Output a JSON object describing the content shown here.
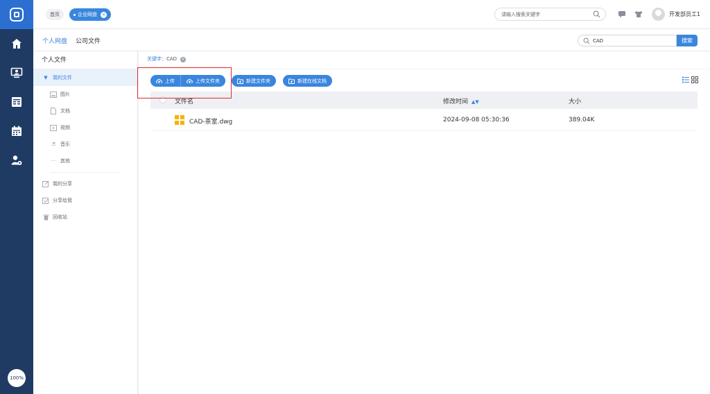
{
  "colors": {
    "accent": "#3a86de",
    "rail": "#1f3b64",
    "rail_logo": "#2b6fd0",
    "highlight_box": "#e02b2b",
    "file_icon": "#f5b400"
  },
  "rail": {
    "items": [
      {
        "name": "home-icon"
      },
      {
        "name": "monitor-user-icon"
      },
      {
        "name": "document-list-icon"
      },
      {
        "name": "calendar-icon"
      },
      {
        "name": "user-settings-icon"
      }
    ],
    "zoom": "100%"
  },
  "topbar": {
    "home_tab": "首页",
    "active_tab": "企业网盘",
    "search_placeholder": "请输入搜索关键字",
    "username": "开发部员工1"
  },
  "tabs": [
    {
      "label": "个人网盘",
      "active": true
    },
    {
      "label": "公司文件",
      "active": false
    }
  ],
  "filter": {
    "value": "CAD",
    "button_label": "搜索"
  },
  "tree": {
    "title": "个人文件",
    "my_files": "我的文件",
    "children": [
      "图片",
      "文档",
      "视频",
      "音乐",
      "其他"
    ],
    "my_share": "我的分享",
    "shared_with_me": "分享给我",
    "recycle_bin": "回收站"
  },
  "main": {
    "keyword_label": "关键字：",
    "keyword_value": "CAD",
    "buttons": {
      "upload": "上传",
      "upload_folder": "上传文件夹",
      "new_folder": "新建文件夹",
      "new_online_doc": "新建在线文档"
    },
    "columns": {
      "name": "文件名",
      "modified": "修改时间",
      "size": "大小"
    },
    "files": [
      {
        "name": "CAD-茶室.dwg",
        "modified": "2024-09-08 05:30:36",
        "size": "389.04K"
      }
    ]
  }
}
